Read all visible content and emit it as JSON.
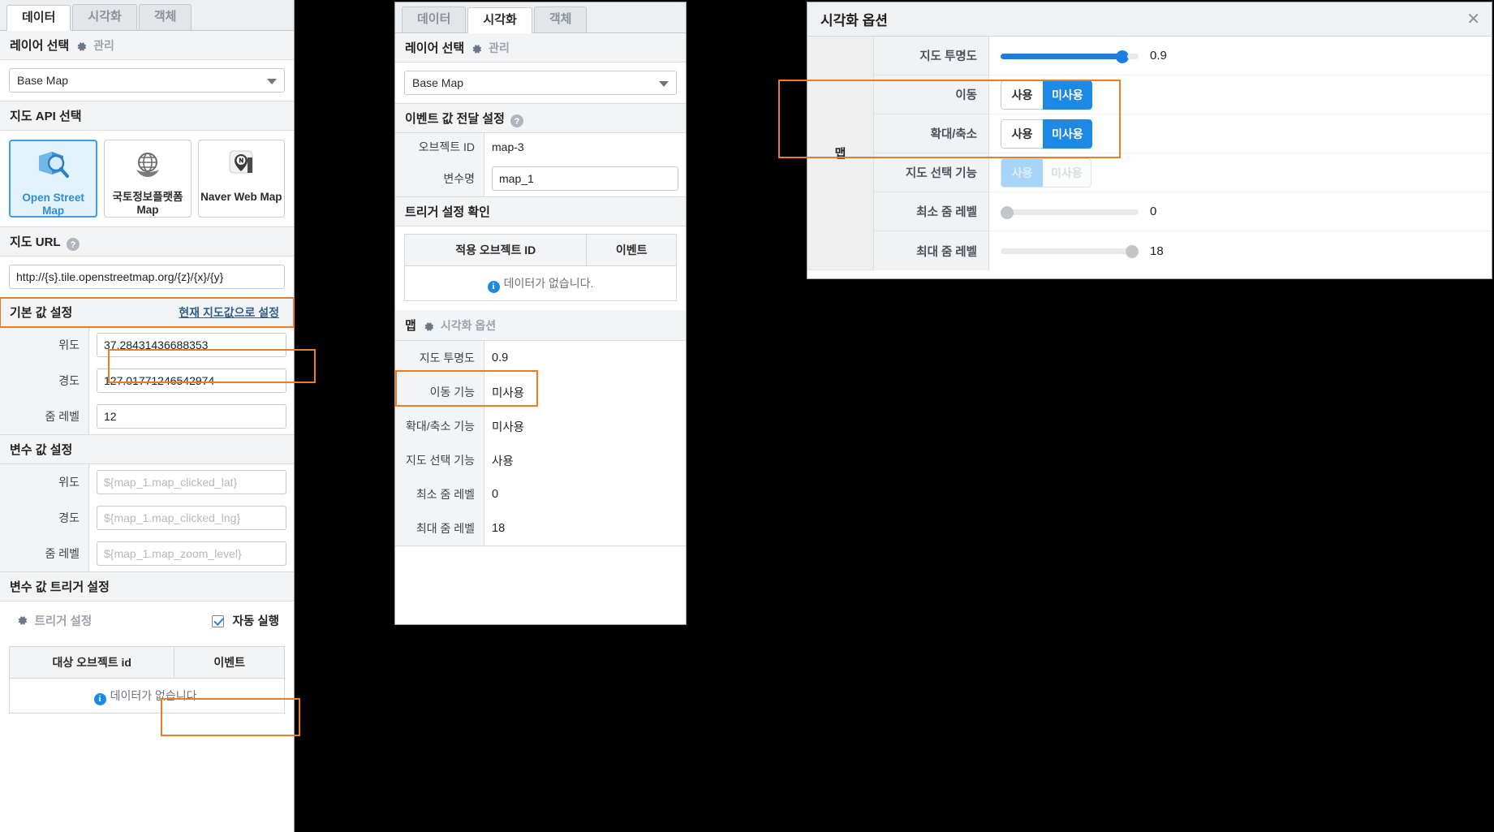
{
  "left_panel": {
    "tabs": [
      {
        "label": "데이터",
        "active": true
      },
      {
        "label": "시각화",
        "active": false
      },
      {
        "label": "객체",
        "active": false
      }
    ],
    "layer_section": {
      "title": "레이어 선택",
      "manage_label": "관리"
    },
    "layer_select": {
      "value": "Base Map"
    },
    "api_section_title": "지도 API 선택",
    "api_cards": [
      {
        "label": "Open Street Map",
        "icon": "osm-magnifier-icon",
        "selected": true
      },
      {
        "label": "국토정보플랫폼 Map",
        "icon": "globe-hands-icon",
        "selected": false
      },
      {
        "label": "Naver Web Map",
        "icon": "naver-pin-icon",
        "selected": false
      }
    ],
    "url_section_title": "지도 URL",
    "url_value": "http://{s}.tile.openstreetmap.org/{z}/{x}/{y}",
    "default_section": {
      "title": "기본 값 설정",
      "action_label": "현재 지도값으로 설정"
    },
    "default_rows": [
      {
        "label": "위도",
        "value": "37.28431436688353"
      },
      {
        "label": "경도",
        "value": "127.01771246542974"
      },
      {
        "label": "줌 레벨",
        "value": "12"
      }
    ],
    "var_section_title": "변수 값 설정",
    "var_rows": [
      {
        "label": "위도",
        "placeholder": "${map_1.map_clicked_lat}"
      },
      {
        "label": "경도",
        "placeholder": "${map_1.map_clicked_lng}"
      },
      {
        "label": "줌 레벨",
        "placeholder": "${map_1.map_zoom_level}"
      }
    ],
    "trigger_section_title": "변수 값 트리거 설정",
    "trigger_bar": {
      "label": "트리거 설정",
      "auto_label": "자동 실행",
      "auto_checked": true
    },
    "trigger_table": {
      "headers": [
        "대상 오브젝트 id",
        "이벤트"
      ],
      "empty_message": "데이터가 없습니다."
    }
  },
  "mid_panel": {
    "tabs": [
      {
        "label": "데이터",
        "active": false
      },
      {
        "label": "시각화",
        "active": true
      },
      {
        "label": "객체",
        "active": false
      }
    ],
    "layer_section": {
      "title": "레이어 선택",
      "manage_label": "관리"
    },
    "layer_select": {
      "value": "Base Map"
    },
    "event_section_title": "이벤트 값 전달 설정",
    "event_rows": [
      {
        "label": "오브젝트 ID",
        "value": "map-3",
        "editable": false
      },
      {
        "label": "변수명",
        "value": "map_1",
        "editable": true
      }
    ],
    "trigger_check_title": "트리거 설정 확인",
    "trigger_table": {
      "headers": [
        "적용 오브젝트 ID",
        "이벤트"
      ],
      "empty_message": "데이터가 없습니다."
    },
    "viz_bar": {
      "prefix": "맵",
      "label": "시각화 옵션"
    },
    "viz_rows": [
      {
        "label": "지도 투명도",
        "value": "0.9"
      },
      {
        "label": "이동 기능",
        "value": "미사용"
      },
      {
        "label": "확대/축소 기능",
        "value": "미사용"
      },
      {
        "label": "지도 선택 기능",
        "value": "사용"
      },
      {
        "label": "최소 줌 레벨",
        "value": "0"
      },
      {
        "label": "최대 줌 레벨",
        "value": "18"
      }
    ]
  },
  "dialog": {
    "title": "시각화 옵션",
    "close_icon": "close-icon",
    "group_label": "맵",
    "rows": [
      {
        "label": "지도 투명도",
        "type": "slider",
        "value": "0.9",
        "pct": 88,
        "enabled": true
      },
      {
        "label": "이동",
        "type": "segment",
        "options": [
          "사용",
          "미사용"
        ],
        "selected": "미사용",
        "enabled": true
      },
      {
        "label": "확대/축소",
        "type": "segment",
        "options": [
          "사용",
          "미사용"
        ],
        "selected": "미사용",
        "enabled": true
      },
      {
        "label": "지도 선택 기능",
        "type": "segment",
        "options": [
          "사용",
          "미사용"
        ],
        "selected": "사용",
        "enabled": false
      },
      {
        "label": "최소 줌 레벨",
        "type": "slider",
        "value": "0",
        "pct": 0,
        "enabled": false
      },
      {
        "label": "최대 줌 레벨",
        "type": "slider",
        "value": "18",
        "pct": 100,
        "enabled": false
      }
    ]
  },
  "colors": {
    "accent_blue": "#1e88e5",
    "highlight_orange": "#f07b22",
    "link_blue": "#2f5e8c",
    "panel_grey": "#f3f4f5"
  }
}
